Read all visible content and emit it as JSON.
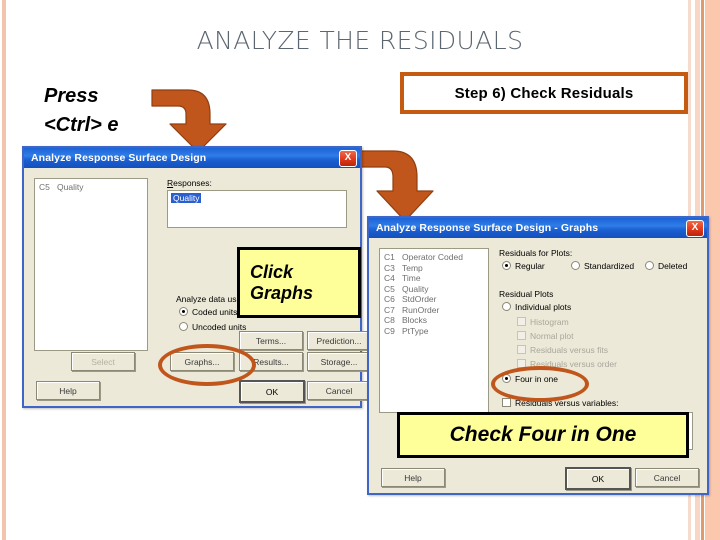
{
  "slide": {
    "title": "ANALYZE THE RESIDUALS",
    "instruction_line1": "Press",
    "instruction_line2": "<Ctrl> e",
    "step_box": "Step 6)  Check Residuals",
    "accent_color": "#c55a11",
    "callout_color": "#ffff99",
    "title_color": "#5c6670"
  },
  "dialog1": {
    "title": "Analyze Response Surface Design",
    "close_label": "X",
    "variables": [
      {
        "col": "C5",
        "name": "Quality"
      }
    ],
    "responses_label": "Responses:",
    "responses_value": "Quality",
    "analyze_group_label": "Analyze data using",
    "radio_coded": "Coded units",
    "radio_uncoded": "Uncoded units",
    "radio_selected": "Coded units",
    "buttons": {
      "select": "Select",
      "terms": "Terms...",
      "prediction": "Prediction...",
      "graphs": "Graphs...",
      "results": "Results...",
      "storage": "Storage...",
      "help": "Help",
      "ok": "OK",
      "cancel": "Cancel"
    },
    "callout": {
      "line1": "Click",
      "line2": "Graphs"
    }
  },
  "dialog2": {
    "title": "Analyze Response Surface Design - Graphs",
    "close_label": "X",
    "variables": [
      {
        "col": "C1",
        "name": "Operator Coded"
      },
      {
        "col": "C3",
        "name": "Temp"
      },
      {
        "col": "C4",
        "name": "Time"
      },
      {
        "col": "C5",
        "name": "Quality"
      },
      {
        "col": "C6",
        "name": "StdOrder"
      },
      {
        "col": "C7",
        "name": "RunOrder"
      },
      {
        "col": "C8",
        "name": "Blocks"
      },
      {
        "col": "C9",
        "name": "PtType"
      }
    ],
    "residuals_for_plots_label": "Residuals for Plots:",
    "residual_types": [
      {
        "label": "Regular",
        "selected": true
      },
      {
        "label": "Standardized",
        "selected": false
      },
      {
        "label": "Deleted",
        "selected": false
      }
    ],
    "residual_plots_label": "Residual Plots",
    "individual_plots_label": "Individual plots",
    "individual_options": [
      "Histogram",
      "Normal plot",
      "Residuals versus fits",
      "Residuals versus order"
    ],
    "four_in_one_label": "Four in one",
    "four_in_one_selected": true,
    "residuals_versus_variables_label": "Residuals versus variables:",
    "buttons": {
      "help": "Help",
      "ok": "OK",
      "cancel": "Cancel"
    },
    "callout": {
      "line1": "Check Four in One"
    }
  }
}
